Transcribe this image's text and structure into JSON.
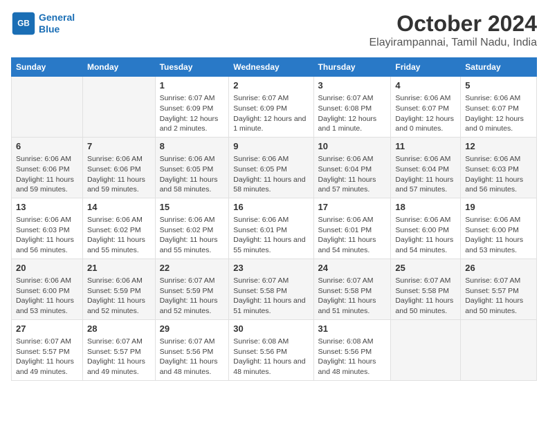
{
  "header": {
    "logo_line1": "General",
    "logo_line2": "Blue",
    "title": "October 2024",
    "subtitle": "Elayirampannai, Tamil Nadu, India"
  },
  "days_of_week": [
    "Sunday",
    "Monday",
    "Tuesday",
    "Wednesday",
    "Thursday",
    "Friday",
    "Saturday"
  ],
  "weeks": [
    [
      {
        "day": "",
        "detail": ""
      },
      {
        "day": "",
        "detail": ""
      },
      {
        "day": "1",
        "detail": "Sunrise: 6:07 AM\nSunset: 6:09 PM\nDaylight: 12 hours\nand 2 minutes."
      },
      {
        "day": "2",
        "detail": "Sunrise: 6:07 AM\nSunset: 6:09 PM\nDaylight: 12 hours\nand 1 minute."
      },
      {
        "day": "3",
        "detail": "Sunrise: 6:07 AM\nSunset: 6:08 PM\nDaylight: 12 hours\nand 1 minute."
      },
      {
        "day": "4",
        "detail": "Sunrise: 6:06 AM\nSunset: 6:07 PM\nDaylight: 12 hours\nand 0 minutes."
      },
      {
        "day": "5",
        "detail": "Sunrise: 6:06 AM\nSunset: 6:07 PM\nDaylight: 12 hours\nand 0 minutes."
      }
    ],
    [
      {
        "day": "6",
        "detail": "Sunrise: 6:06 AM\nSunset: 6:06 PM\nDaylight: 11 hours\nand 59 minutes."
      },
      {
        "day": "7",
        "detail": "Sunrise: 6:06 AM\nSunset: 6:06 PM\nDaylight: 11 hours\nand 59 minutes."
      },
      {
        "day": "8",
        "detail": "Sunrise: 6:06 AM\nSunset: 6:05 PM\nDaylight: 11 hours\nand 58 minutes."
      },
      {
        "day": "9",
        "detail": "Sunrise: 6:06 AM\nSunset: 6:05 PM\nDaylight: 11 hours\nand 58 minutes."
      },
      {
        "day": "10",
        "detail": "Sunrise: 6:06 AM\nSunset: 6:04 PM\nDaylight: 11 hours\nand 57 minutes."
      },
      {
        "day": "11",
        "detail": "Sunrise: 6:06 AM\nSunset: 6:04 PM\nDaylight: 11 hours\nand 57 minutes."
      },
      {
        "day": "12",
        "detail": "Sunrise: 6:06 AM\nSunset: 6:03 PM\nDaylight: 11 hours\nand 56 minutes."
      }
    ],
    [
      {
        "day": "13",
        "detail": "Sunrise: 6:06 AM\nSunset: 6:03 PM\nDaylight: 11 hours\nand 56 minutes."
      },
      {
        "day": "14",
        "detail": "Sunrise: 6:06 AM\nSunset: 6:02 PM\nDaylight: 11 hours\nand 55 minutes."
      },
      {
        "day": "15",
        "detail": "Sunrise: 6:06 AM\nSunset: 6:02 PM\nDaylight: 11 hours\nand 55 minutes."
      },
      {
        "day": "16",
        "detail": "Sunrise: 6:06 AM\nSunset: 6:01 PM\nDaylight: 11 hours\nand 55 minutes."
      },
      {
        "day": "17",
        "detail": "Sunrise: 6:06 AM\nSunset: 6:01 PM\nDaylight: 11 hours\nand 54 minutes."
      },
      {
        "day": "18",
        "detail": "Sunrise: 6:06 AM\nSunset: 6:00 PM\nDaylight: 11 hours\nand 54 minutes."
      },
      {
        "day": "19",
        "detail": "Sunrise: 6:06 AM\nSunset: 6:00 PM\nDaylight: 11 hours\nand 53 minutes."
      }
    ],
    [
      {
        "day": "20",
        "detail": "Sunrise: 6:06 AM\nSunset: 6:00 PM\nDaylight: 11 hours\nand 53 minutes."
      },
      {
        "day": "21",
        "detail": "Sunrise: 6:06 AM\nSunset: 5:59 PM\nDaylight: 11 hours\nand 52 minutes."
      },
      {
        "day": "22",
        "detail": "Sunrise: 6:07 AM\nSunset: 5:59 PM\nDaylight: 11 hours\nand 52 minutes."
      },
      {
        "day": "23",
        "detail": "Sunrise: 6:07 AM\nSunset: 5:58 PM\nDaylight: 11 hours\nand 51 minutes."
      },
      {
        "day": "24",
        "detail": "Sunrise: 6:07 AM\nSunset: 5:58 PM\nDaylight: 11 hours\nand 51 minutes."
      },
      {
        "day": "25",
        "detail": "Sunrise: 6:07 AM\nSunset: 5:58 PM\nDaylight: 11 hours\nand 50 minutes."
      },
      {
        "day": "26",
        "detail": "Sunrise: 6:07 AM\nSunset: 5:57 PM\nDaylight: 11 hours\nand 50 minutes."
      }
    ],
    [
      {
        "day": "27",
        "detail": "Sunrise: 6:07 AM\nSunset: 5:57 PM\nDaylight: 11 hours\nand 49 minutes."
      },
      {
        "day": "28",
        "detail": "Sunrise: 6:07 AM\nSunset: 5:57 PM\nDaylight: 11 hours\nand 49 minutes."
      },
      {
        "day": "29",
        "detail": "Sunrise: 6:07 AM\nSunset: 5:56 PM\nDaylight: 11 hours\nand 48 minutes."
      },
      {
        "day": "30",
        "detail": "Sunrise: 6:08 AM\nSunset: 5:56 PM\nDaylight: 11 hours\nand 48 minutes."
      },
      {
        "day": "31",
        "detail": "Sunrise: 6:08 AM\nSunset: 5:56 PM\nDaylight: 11 hours\nand 48 minutes."
      },
      {
        "day": "",
        "detail": ""
      },
      {
        "day": "",
        "detail": ""
      }
    ]
  ]
}
